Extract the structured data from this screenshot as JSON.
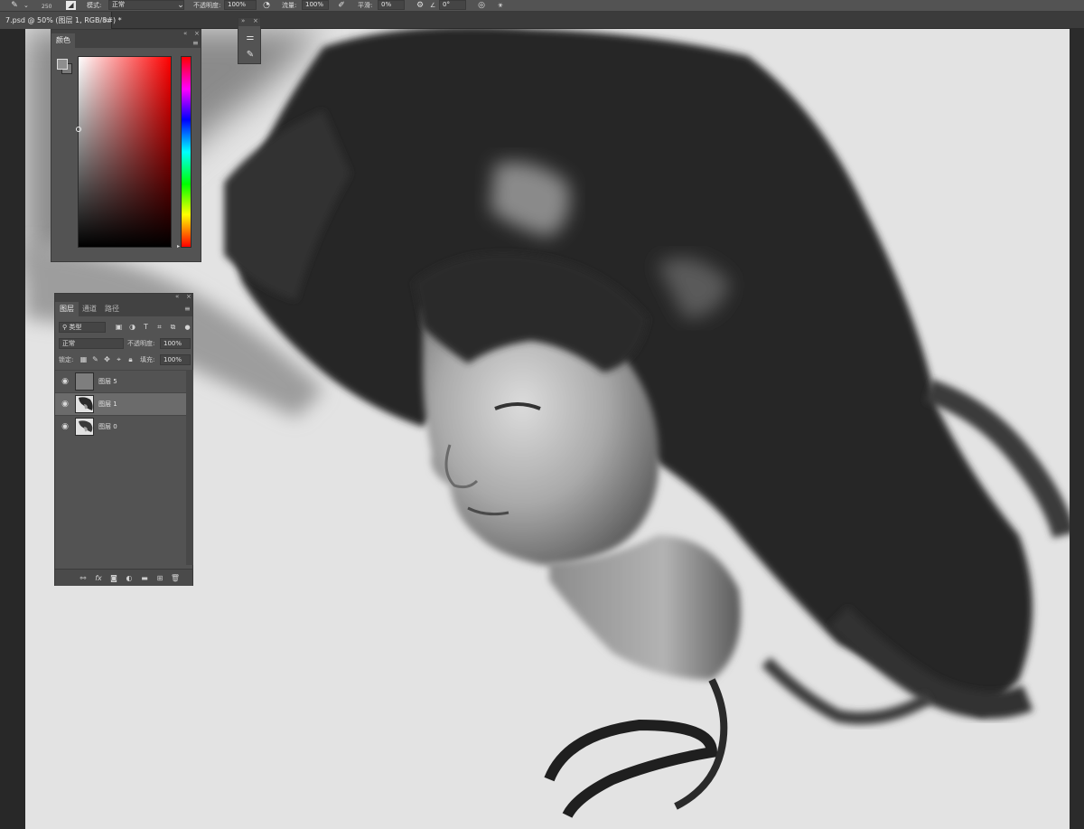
{
  "options_bar": {
    "brush_size": "250",
    "mode_label": "模式:",
    "mode_value": "正常",
    "opacity_label": "不透明度:",
    "opacity_value": "100%",
    "flow_label": "流量:",
    "flow_value": "100%",
    "smoothing_label": "平滑:",
    "smoothing_value": "0%",
    "angle_value": "0°"
  },
  "document_tab": {
    "title": "7.psd @ 50% (图层 1, RGB/8#) *",
    "close": "×"
  },
  "color_panel": {
    "tab": "颜色",
    "collapse": "«",
    "close": "×",
    "menu": "≡",
    "foreground_color": "#8e8e8e",
    "background_color": "#7a7a7a",
    "hue_color": "#ff0000"
  },
  "mini_panel": {
    "collapse": "»",
    "close": "×"
  },
  "layers_panel": {
    "collapse": "«",
    "close": "×",
    "menu": "≡",
    "tabs": [
      {
        "label": "图层",
        "active": true
      },
      {
        "label": "通道",
        "active": false
      },
      {
        "label": "路径",
        "active": false
      }
    ],
    "filter_kind": "类型",
    "blend_mode": "正常",
    "opacity_label": "不透明度:",
    "opacity_value": "100%",
    "lock_label": "锁定:",
    "fill_label": "填充:",
    "fill_value": "100%",
    "layers": [
      {
        "name": "图层 5",
        "selected": false,
        "visible": true
      },
      {
        "name": "图层 1",
        "selected": true,
        "visible": true
      },
      {
        "name": "图层 0",
        "selected": false,
        "visible": true
      }
    ]
  }
}
